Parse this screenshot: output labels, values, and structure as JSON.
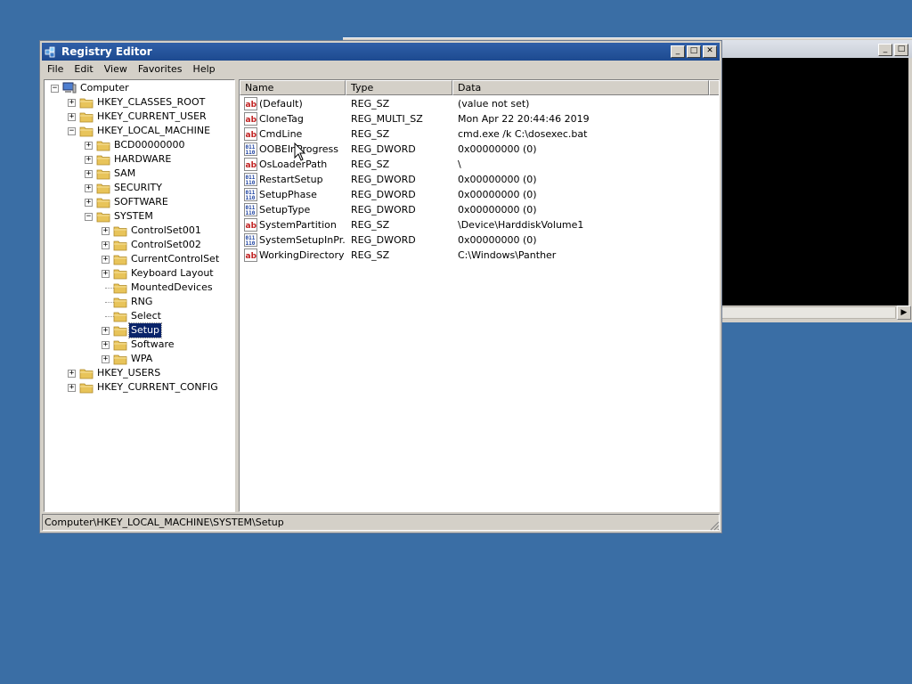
{
  "window": {
    "title": "Registry Editor",
    "buttons": {
      "minimize": "_",
      "maximize": "□",
      "close": "✕"
    }
  },
  "background_window": {
    "buttons": {
      "minimize": "_",
      "maximize": "□",
      "close": "✕"
    },
    "scroll_right": "▶"
  },
  "menubar": {
    "items": [
      "File",
      "Edit",
      "View",
      "Favorites",
      "Help"
    ]
  },
  "tree": {
    "expand_glyphs": {
      "expanded": "−",
      "collapsed": "+"
    },
    "nodes": [
      {
        "label": "Computer",
        "depth": 0,
        "expander": "expanded",
        "icon": "computer-icon"
      },
      {
        "label": "HKEY_CLASSES_ROOT",
        "depth": 1,
        "expander": "collapsed"
      },
      {
        "label": "HKEY_CURRENT_USER",
        "depth": 1,
        "expander": "collapsed"
      },
      {
        "label": "HKEY_LOCAL_MACHINE",
        "depth": 1,
        "expander": "expanded"
      },
      {
        "label": "BCD00000000",
        "depth": 2,
        "expander": "collapsed"
      },
      {
        "label": "HARDWARE",
        "depth": 2,
        "expander": "collapsed"
      },
      {
        "label": "SAM",
        "depth": 2,
        "expander": "collapsed"
      },
      {
        "label": "SECURITY",
        "depth": 2,
        "expander": "collapsed"
      },
      {
        "label": "SOFTWARE",
        "depth": 2,
        "expander": "collapsed"
      },
      {
        "label": "SYSTEM",
        "depth": 2,
        "expander": "expanded"
      },
      {
        "label": "ControlSet001",
        "depth": 3,
        "expander": "collapsed"
      },
      {
        "label": "ControlSet002",
        "depth": 3,
        "expander": "collapsed"
      },
      {
        "label": "CurrentControlSet",
        "depth": 3,
        "expander": "collapsed"
      },
      {
        "label": "Keyboard Layout",
        "depth": 3,
        "expander": "collapsed"
      },
      {
        "label": "MountedDevices",
        "depth": 3,
        "expander": "none"
      },
      {
        "label": "RNG",
        "depth": 3,
        "expander": "none"
      },
      {
        "label": "Select",
        "depth": 3,
        "expander": "none"
      },
      {
        "label": "Setup",
        "depth": 3,
        "expander": "collapsed",
        "selected": true
      },
      {
        "label": "Software",
        "depth": 3,
        "expander": "collapsed"
      },
      {
        "label": "WPA",
        "depth": 3,
        "expander": "collapsed"
      },
      {
        "label": "HKEY_USERS",
        "depth": 1,
        "expander": "collapsed"
      },
      {
        "label": "HKEY_CURRENT_CONFIG",
        "depth": 1,
        "expander": "collapsed"
      }
    ]
  },
  "list": {
    "columns": [
      "Name",
      "Type",
      "Data"
    ],
    "rows": [
      {
        "name": "(Default)",
        "type": "REG_SZ",
        "data": "(value not set)",
        "icon": "string-value-icon"
      },
      {
        "name": "CloneTag",
        "type": "REG_MULTI_SZ",
        "data": "Mon Apr 22 20:44:46 2019",
        "icon": "string-value-icon"
      },
      {
        "name": "CmdLine",
        "type": "REG_SZ",
        "data": "cmd.exe /k C:\\dosexec.bat",
        "icon": "string-value-icon"
      },
      {
        "name": "OOBEInProgress",
        "type": "REG_DWORD",
        "data": "0x00000000 (0)",
        "icon": "binary-value-icon"
      },
      {
        "name": "OsLoaderPath",
        "type": "REG_SZ",
        "data": "\\",
        "icon": "string-value-icon"
      },
      {
        "name": "RestartSetup",
        "type": "REG_DWORD",
        "data": "0x00000000 (0)",
        "icon": "binary-value-icon"
      },
      {
        "name": "SetupPhase",
        "type": "REG_DWORD",
        "data": "0x00000000 (0)",
        "icon": "binary-value-icon"
      },
      {
        "name": "SetupType",
        "type": "REG_DWORD",
        "data": "0x00000000 (0)",
        "icon": "binary-value-icon"
      },
      {
        "name": "SystemPartition",
        "type": "REG_SZ",
        "data": "\\Device\\HarddiskVolume1",
        "icon": "string-value-icon"
      },
      {
        "name": "SystemSetupInPr...",
        "type": "REG_DWORD",
        "data": "0x00000000 (0)",
        "icon": "binary-value-icon"
      },
      {
        "name": "WorkingDirectory",
        "type": "REG_SZ",
        "data": "C:\\Windows\\Panther",
        "icon": "string-value-icon"
      }
    ]
  },
  "status": {
    "path": "Computer\\HKEY_LOCAL_MACHINE\\SYSTEM\\Setup"
  },
  "colors": {
    "desktop": "#3a6ea5",
    "titlebar": "#1d4a90",
    "selection": "#0a246a",
    "folder": "#e8c45a"
  }
}
